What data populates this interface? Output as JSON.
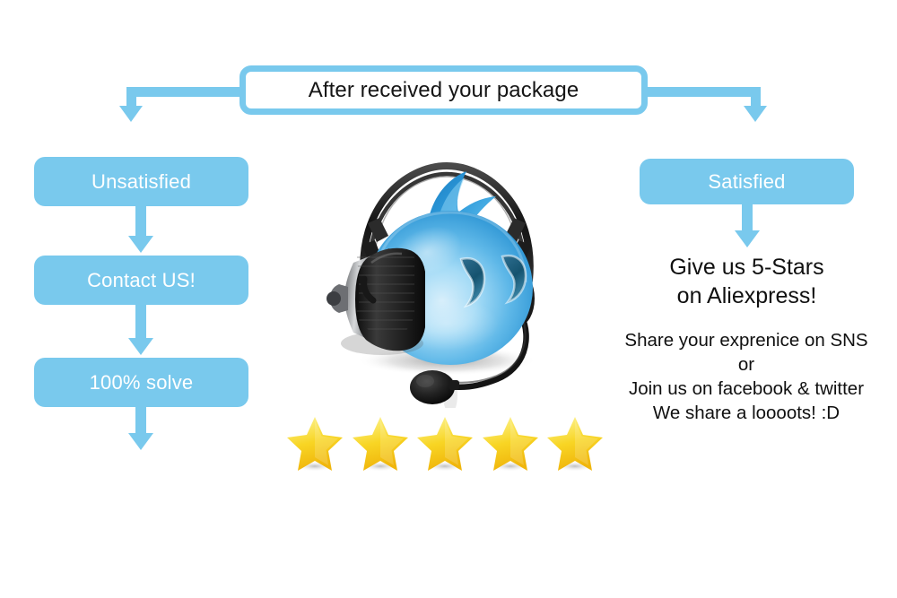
{
  "banner": {
    "title": "After received your package",
    "accent_color": "#79c9ed",
    "text_color": "#101010",
    "background": "#ffffff"
  },
  "flow": {
    "left_branch": {
      "steps": [
        {
          "label": "Unsatisfied"
        },
        {
          "label": "Contact US!"
        },
        {
          "label": "100% solve"
        }
      ]
    },
    "right_branch": {
      "steps": [
        {
          "label": "Satisfied"
        }
      ],
      "call_to_action": {
        "line1": "Give us 5-Stars",
        "line2": "on Aliexpress!"
      },
      "share_message": {
        "line1": "Share your exprenice on SNS",
        "line2": "or",
        "line3": "Join us on facebook & twitter",
        "line4": "We share a loooots! :D"
      }
    }
  },
  "rating": {
    "star_count": 5,
    "stars": [
      {
        "filled": true
      },
      {
        "filled": true
      },
      {
        "filled": true
      },
      {
        "filled": true
      },
      {
        "filled": true
      }
    ],
    "star_color": "#f7d417",
    "star_highlight": "#fdf39a"
  },
  "mascot": {
    "name": "support-agent-droplet-mascot",
    "body_color": "#3aa8e0",
    "headset_color": "#1d1d1d",
    "description": "blue droplet character wearing a headset with boom microphone"
  }
}
